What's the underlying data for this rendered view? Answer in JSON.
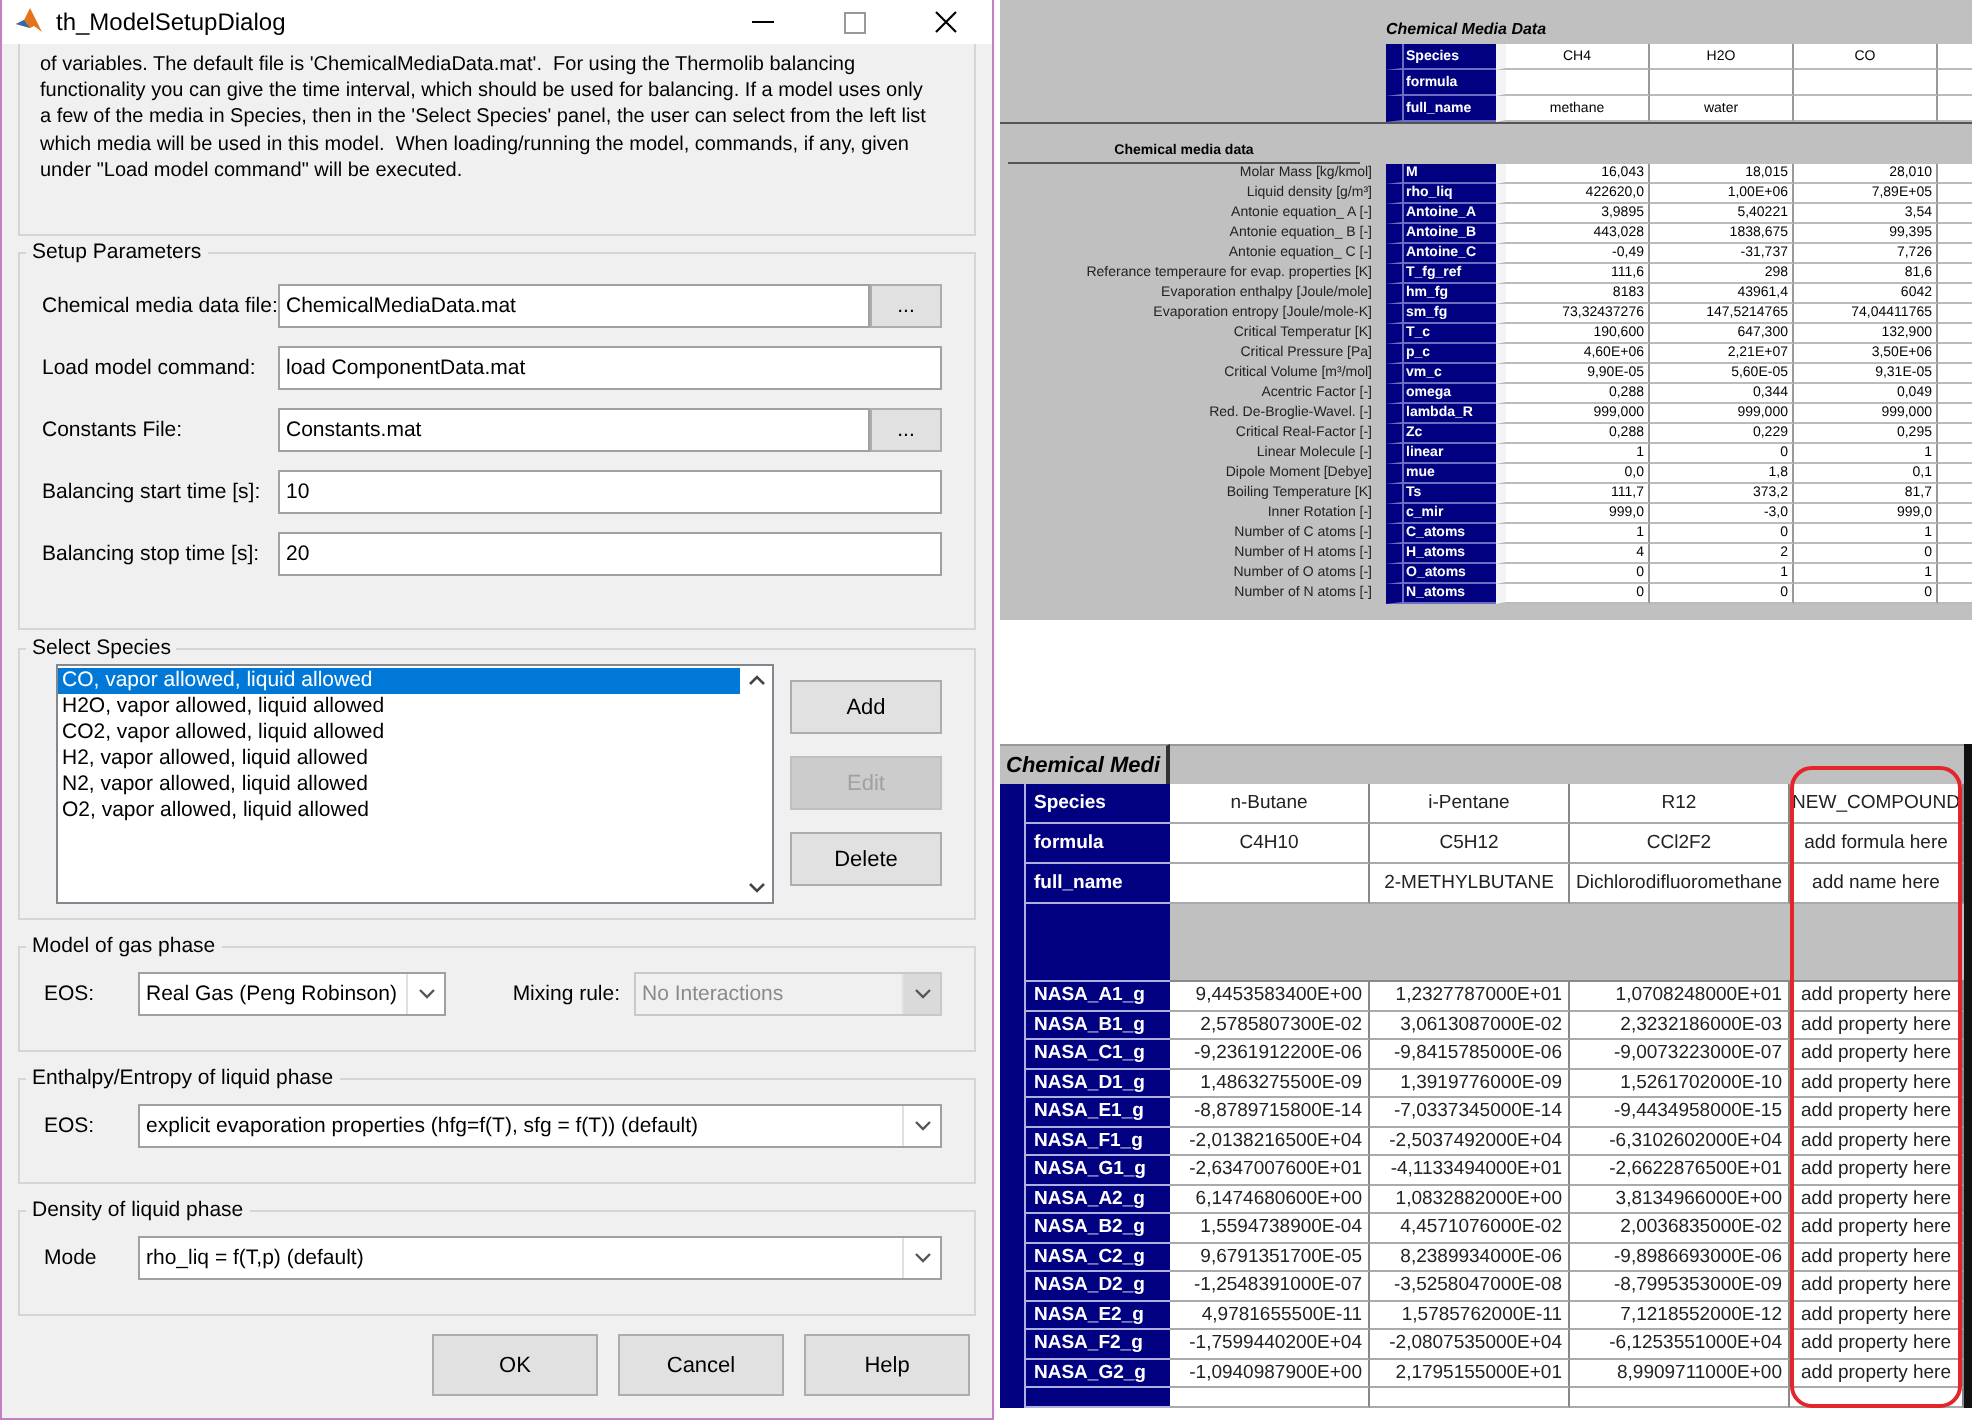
{
  "dialog": {
    "title": "th_ModelSetupDialog",
    "description_lines": [
      "of variables. The default file is 'ChemicalMediaData.mat'.  For using the Thermolib balancing",
      "functionality you can give the time interval, which should be used for balancing. If a model uses only",
      "a few of the media in Species, then in the 'Select Species' panel, the user can select from the left list",
      "which media will be used in this model.  When loading/running the model, commands, if any, given",
      "under \"Load model command\" will be executed."
    ],
    "setup_parameters": {
      "title": "Setup Parameters",
      "fields": [
        {
          "label": "Chemical media data file:",
          "value": "ChemicalMediaData.mat",
          "browse": "..."
        },
        {
          "label": "Load model command:",
          "value": "load ComponentData.mat"
        },
        {
          "label": "Constants File:",
          "value": "Constants.mat",
          "browse": "..."
        },
        {
          "label": "Balancing start time [s]:",
          "value": "10"
        },
        {
          "label": "Balancing stop time [s]:",
          "value": "20"
        }
      ]
    },
    "select_species": {
      "title": "Select Species",
      "items": [
        {
          "label": "CO, vapor allowed, liquid allowed",
          "selected": true
        },
        {
          "label": "H2O, vapor allowed, liquid allowed",
          "selected": false
        },
        {
          "label": "CO2, vapor allowed, liquid allowed",
          "selected": false
        },
        {
          "label": "H2, vapor allowed, liquid allowed",
          "selected": false
        },
        {
          "label": "N2, vapor allowed, liquid allowed",
          "selected": false
        },
        {
          "label": "O2, vapor allowed, liquid allowed",
          "selected": false
        }
      ],
      "buttons": [
        {
          "label": "Add",
          "disabled": false
        },
        {
          "label": "Edit",
          "disabled": true
        },
        {
          "label": "Delete",
          "disabled": false
        }
      ]
    },
    "option_panels": [
      {
        "title": "Model of gas phase",
        "selects": [
          {
            "label": "EOS:",
            "value": "Real Gas (Peng Robinson)",
            "disabled": false
          },
          {
            "label": "Mixing rule:",
            "value": "No Interactions",
            "disabled": true
          }
        ]
      },
      {
        "title": "Enthalpy/Entropy of liquid phase",
        "selects": [
          {
            "label": "EOS:",
            "value": "explicit evaporation properties (hfg=f(T), sfg = f(T)) (default)",
            "disabled": false
          }
        ]
      },
      {
        "title": "Density of liquid phase",
        "selects": [
          {
            "label": "Mode",
            "value": "rho_liq = f(T,p) (default)",
            "disabled": false
          }
        ]
      }
    ],
    "buttons": [
      "OK",
      "Cancel",
      "Help"
    ]
  },
  "media_sheet": {
    "title": "Chemical Media Data",
    "header_keys": [
      "Species",
      "formula",
      "full_name"
    ],
    "columns": [
      {
        "species": "CH4",
        "full_name": "methane"
      },
      {
        "species": "H2O",
        "full_name": "water"
      },
      {
        "species": "CO"
      }
    ],
    "section_title": "Chemical media data",
    "rows": [
      {
        "label": "Molar Mass  [kg/kmol]",
        "key": "M",
        "values": [
          "16,043",
          "18,015",
          "28,010"
        ]
      },
      {
        "label": "Liquid density  [g/m³]",
        "key": "rho_liq",
        "values": [
          "422620,0",
          "1,00E+06",
          "7,89E+05"
        ]
      },
      {
        "label": "Antonie equation_ A  [-]",
        "key": "Antoine_A",
        "values": [
          "3,9895",
          "5,40221",
          "3,54"
        ]
      },
      {
        "label": "Antonie equation_ B  [-]",
        "key": "Antoine_B",
        "values": [
          "443,028",
          "1838,675",
          "99,395"
        ]
      },
      {
        "label": "Antonie equation_ C  [-]",
        "key": "Antoine_C",
        "values": [
          "-0,49",
          "-31,737",
          "7,726"
        ]
      },
      {
        "label": "Referance temperaure for evap. properties  [K]",
        "key": "T_fg_ref",
        "values": [
          "111,6",
          "298",
          "81,6"
        ]
      },
      {
        "label": "Evaporation enthalpy  [Joule/mole]",
        "key": "hm_fg",
        "values": [
          "8183",
          "43961,4",
          "6042"
        ]
      },
      {
        "label": "Evaporation entropy  [Joule/mole-K]",
        "key": "sm_fg",
        "values": [
          "73,32437276",
          "147,5214765",
          "74,04411765"
        ]
      },
      {
        "label": "Critical Temperatur  [K]",
        "key": "T_c",
        "values": [
          "190,600",
          "647,300",
          "132,900"
        ]
      },
      {
        "label": "Critical Pressure  [Pa]",
        "key": "p_c",
        "values": [
          "4,60E+06",
          "2,21E+07",
          "3,50E+06"
        ]
      },
      {
        "label": "Critical Volume  [m³/mol]",
        "key": "vm_c",
        "values": [
          "9,90E-05",
          "5,60E-05",
          "9,31E-05"
        ]
      },
      {
        "label": "Acentric Factor  [-]",
        "key": "omega",
        "values": [
          "0,288",
          "0,344",
          "0,049"
        ]
      },
      {
        "label": "Red. De-Broglie-Wavel.  [-]",
        "key": "lambda_R",
        "values": [
          "999,000",
          "999,000",
          "999,000"
        ]
      },
      {
        "label": "Critical Real-Factor  [-]",
        "key": "Zc",
        "values": [
          "0,288",
          "0,229",
          "0,295"
        ]
      },
      {
        "label": "Linear Molecule  [-]",
        "key": "linear",
        "values": [
          "1",
          "0",
          "1"
        ]
      },
      {
        "label": "Dipole Moment  [Debye]",
        "key": "mue",
        "values": [
          "0,0",
          "1,8",
          "0,1"
        ]
      },
      {
        "label": "Boiling Temperature  [K]",
        "key": "Ts",
        "values": [
          "111,7",
          "373,2",
          "81,7"
        ]
      },
      {
        "label": "Inner Rotation  [-]",
        "key": "c_mir",
        "values": [
          "999,0",
          "-3,0",
          "999,0"
        ]
      },
      {
        "label": "Number of C atoms [-]",
        "key": "C_atoms",
        "values": [
          "1",
          "0",
          "1"
        ]
      },
      {
        "label": "Number of H atoms [-]",
        "key": "H_atoms",
        "values": [
          "4",
          "2",
          "0"
        ]
      },
      {
        "label": "Number of O atoms [-]",
        "key": "O_atoms",
        "values": [
          "0",
          "1",
          "1"
        ]
      },
      {
        "label": "Number of N atoms [-]",
        "key": "N_atoms",
        "values": [
          "0",
          "0",
          "0"
        ]
      }
    ]
  },
  "compound_table": {
    "title": "Chemical Medi",
    "header_keys": [
      "Species",
      "formula",
      "full_name"
    ],
    "columns": [
      {
        "species": "n-Butane",
        "formula": "C4H10",
        "highlighted": false
      },
      {
        "species": "i-Pentane",
        "formula": "C5H12",
        "full_name": "2-METHYLBUTANE",
        "highlighted": false
      },
      {
        "species": "R12",
        "formula": "CCl2F2",
        "full_name": "Dichlorodifluoromethane",
        "highlighted": false
      },
      {
        "species": "NEW_COMPOUND",
        "formula": "add formula here",
        "full_name": "add name here",
        "highlighted": true
      }
    ],
    "rows": [
      {
        "key": "NASA_A1_g",
        "values": [
          "9,4453583400E+00",
          "1,2327787000E+01",
          "1,0708248000E+01",
          "add property here"
        ]
      },
      {
        "key": "NASA_B1_g",
        "values": [
          "2,5785807300E-02",
          "3,0613087000E-02",
          "2,3232186000E-03",
          "add property here"
        ]
      },
      {
        "key": "NASA_C1_g",
        "values": [
          "-9,2361912200E-06",
          "-9,8415785000E-06",
          "-9,0073223000E-07",
          "add property here"
        ]
      },
      {
        "key": "NASA_D1_g",
        "values": [
          "1,4863275500E-09",
          "1,3919776000E-09",
          "1,5261702000E-10",
          "add property here"
        ]
      },
      {
        "key": "NASA_E1_g",
        "values": [
          "-8,8789715800E-14",
          "-7,0337345000E-14",
          "-9,4434958000E-15",
          "add property here"
        ]
      },
      {
        "key": "NASA_F1_g",
        "values": [
          "-2,0138216500E+04",
          "-2,5037492000E+04",
          "-6,3102602000E+04",
          "add property here"
        ]
      },
      {
        "key": "NASA_G1_g",
        "values": [
          "-2,6347007600E+01",
          "-4,1133494000E+01",
          "-2,6622876500E+01",
          "add property here"
        ]
      },
      {
        "key": "NASA_A2_g",
        "values": [
          "6,1474680600E+00",
          "1,0832882000E+00",
          "3,8134966000E+00",
          "add property here"
        ]
      },
      {
        "key": "NASA_B2_g",
        "values": [
          "1,5594738900E-04",
          "4,4571076000E-02",
          "2,0036835000E-02",
          "add property here"
        ]
      },
      {
        "key": "NASA_C2_g",
        "values": [
          "9,6791351700E-05",
          "8,2389934000E-06",
          "-9,8986693000E-06",
          "add property here"
        ]
      },
      {
        "key": "NASA_D2_g",
        "values": [
          "-1,2548391000E-07",
          "-3,5258047000E-08",
          "-8,7995353000E-09",
          "add property here"
        ]
      },
      {
        "key": "NASA_E2_g",
        "values": [
          "4,9781655500E-11",
          "1,5785762000E-11",
          "7,1218552000E-12",
          "add property here"
        ]
      },
      {
        "key": "NASA_F2_g",
        "values": [
          "-1,7599440200E+04",
          "-2,0807535000E+04",
          "-6,1253551000E+04",
          "add property here"
        ]
      },
      {
        "key": "NASA_G2_g",
        "values": [
          "-1,0940987900E+00",
          "2,1795155000E+01",
          "8,9909711000E+00",
          "add property here"
        ]
      }
    ]
  }
}
